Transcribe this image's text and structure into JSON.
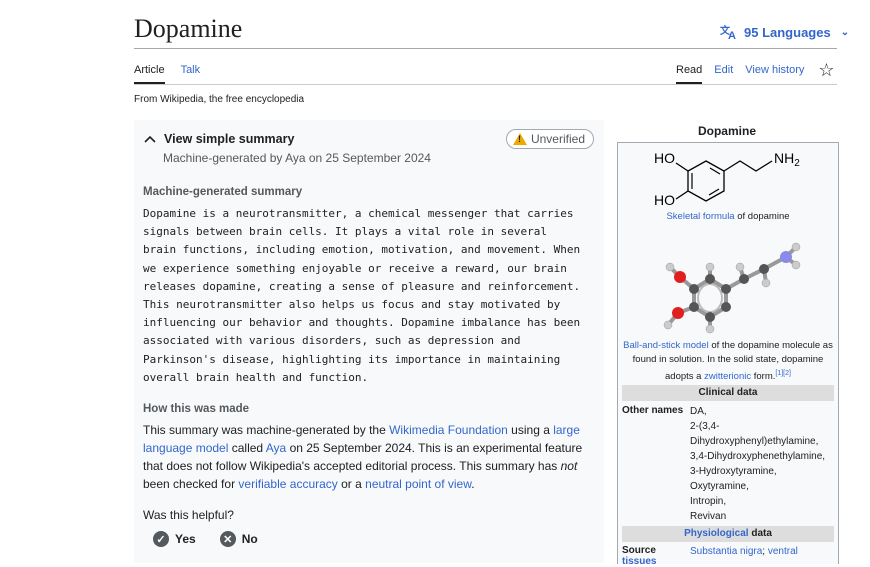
{
  "article": {
    "title": "Dopamine",
    "languages": "95 Languages",
    "tagline": "From Wikipedia, the free encyclopedia"
  },
  "tabs": {
    "article": "Article",
    "talk": "Talk",
    "read": "Read",
    "edit": "Edit",
    "history": "View history"
  },
  "summary": {
    "toggle": "View simple summary",
    "meta": "Machine-generated by Aya on 25 September 2024",
    "badge": "Unverified",
    "heading": "Machine-generated summary",
    "lines": [
      "Dopamine is a neurotransmitter, a chemical messenger that carries",
      "signals between brain cells. It plays a vital role in several",
      "brain functions, including emotion, motivation, and movement. When",
      "we experience something enjoyable or receive a reward, our brain",
      "releases dopamine, creating a sense of pleasure and reinforcement.",
      "This neurotransmitter also helps us focus and stay motivated by",
      "influencing our behavior and thoughts. Dopamine imbalance has been",
      "associated with various disorders, such as depression and",
      "Parkinson's disease, highlighting its importance in maintaining",
      "overall brain health and function."
    ],
    "how_heading": "How this was made",
    "how": {
      "t1": "This summary was machine-generated by the ",
      "l1": "Wikimedia Foundation",
      "t2": " using a ",
      "l2": "large language model",
      "t3": " called ",
      "l3": "Aya",
      "t4": " on 25 September 2024. This is an experimental feature that does not follow Wikipedia's accepted editorial process. This summary has ",
      "em": "not",
      "t5": " been checked for ",
      "l4": "verifiable accuracy",
      "t6": " or a ",
      "l5": "neutral point of view",
      "t7": "."
    },
    "helpful": "Was this helpful?",
    "yes": "Yes",
    "no": "No"
  },
  "infobox": {
    "title": "Dopamine",
    "skeletal": {
      "ho1": "HO",
      "ho2": "HO",
      "nh2": "NH",
      "nh2_sub": "2",
      "link": "Skeletal formula",
      "rest": " of dopamine"
    },
    "ballstick": {
      "link1": "Ball-and-stick model",
      "t1": " of the dopamine molecule as found in solution. In the solid state, dopamine adopts a ",
      "link2": "zwitterionic",
      "t2": " form.",
      "refs": "[1][2]"
    },
    "clinical": "Clinical data",
    "other_names_label": "Other names",
    "other_names": [
      "DA,",
      "2-(3,4-",
      "Dihydroxyphenyl)ethylamine,",
      "3,4-Dihydroxyphenethylamine,",
      "3-Hydroxytyramine,",
      "Oxytyramine,",
      "Intropin,",
      "Revivan"
    ],
    "physio_link": "Physiological",
    "physio_rest": " data",
    "source_label": "Source",
    "source_label2": "tissues",
    "source_link1": "Substantia nigra",
    "source_sep": "; ",
    "source_link2": "ventral"
  },
  "colors": {
    "link": "#3366cc",
    "text": "#202122",
    "warn": "#edab00",
    "panel": "#f8f9fa"
  }
}
